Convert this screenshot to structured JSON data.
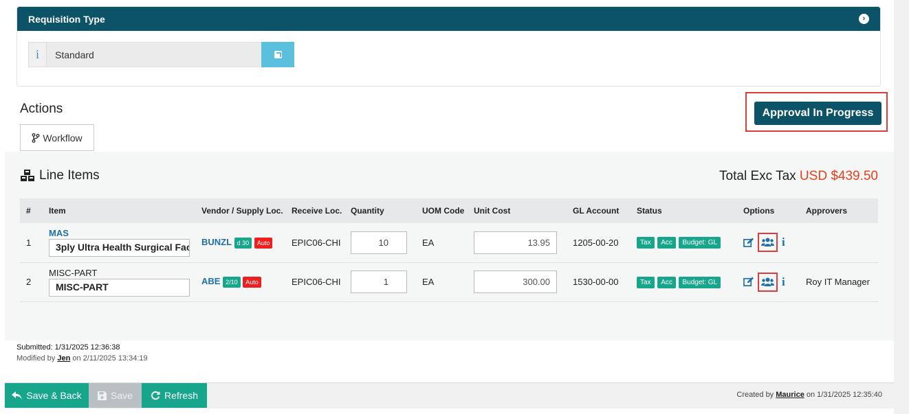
{
  "requisition": {
    "header": "Requisition Type",
    "value": "Standard"
  },
  "actions": {
    "title": "Actions",
    "workflow_label": "Workflow",
    "approval_label": "Approval In Progress"
  },
  "line_items": {
    "title": "Line Items",
    "total_label": "Total Exc Tax",
    "total_amount": "USD $439.50",
    "columns": [
      "#",
      "Item",
      "Vendor / Supply Loc.",
      "Receive Loc.",
      "Quantity",
      "UOM Code",
      "Unit Cost",
      "GL Account",
      "Status",
      "Options",
      "Approvers"
    ],
    "rows": [
      {
        "num": "1",
        "code": "MAS",
        "desc": "3ply Ultra Health Surgical Fac",
        "vendor": "BUNZL",
        "term_badge": "d 30",
        "auto_badge": "Auto",
        "receive": "EPIC06-CHI",
        "qty": "10",
        "uom": "EA",
        "unit_cost": "13.95",
        "gl": "1205-00-20",
        "status_tax": "Tax",
        "status_acc": "Acc",
        "status_budget": "Budget: GL",
        "approvers": ""
      },
      {
        "num": "2",
        "code": "MISC-PART",
        "desc": "MISC-PART",
        "vendor": "ABE",
        "term_badge": "2/10",
        "auto_badge": "Auto",
        "receive": "EPIC06-CHI",
        "qty": "1",
        "uom": "EA",
        "unit_cost": "300.00",
        "gl": "1530-00-00",
        "status_tax": "Tax",
        "status_acc": "Acc",
        "status_budget": "Budget: GL",
        "approvers": "Roy IT Manager"
      }
    ]
  },
  "meta": {
    "submitted": "Submitted: 1/31/2025 12:36:38",
    "modified_prefix": "Modified by",
    "modified_user": "Jen",
    "modified_suffix": "on 2/11/2025 13:34:19"
  },
  "footer": {
    "save_back": "Save & Back",
    "save": "Save",
    "refresh": "Refresh",
    "created_prefix": "Created by",
    "created_user": "Maurice",
    "created_suffix": "on 1/31/2025 12:35:40"
  },
  "colors": {
    "primary": "#0d5367",
    "teal": "#17a58c",
    "red": "#ee1f1f",
    "link": "#1f6fa8",
    "total": "#e8401c"
  }
}
